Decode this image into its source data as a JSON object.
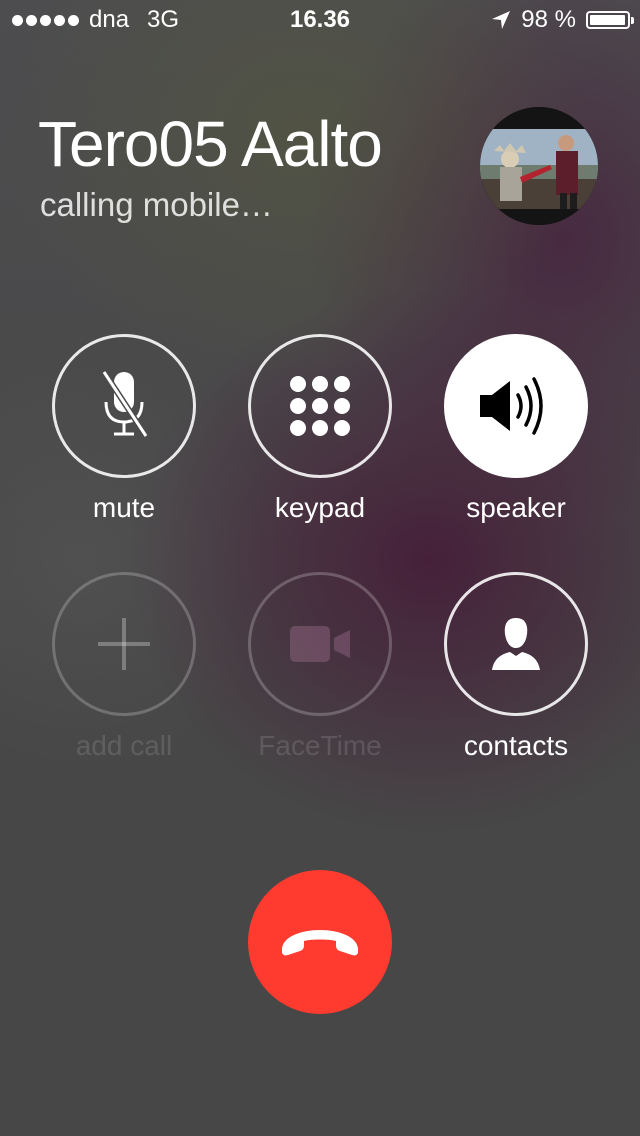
{
  "status_bar": {
    "carrier": "dna",
    "network": "3G",
    "time": "16.36",
    "battery": "98 %",
    "battery_level": 0.98,
    "icons": [
      "signal-dots-icon",
      "location-arrow-icon",
      "battery-icon"
    ]
  },
  "caller": {
    "name": "Tero05 Aalto",
    "status": "calling mobile…"
  },
  "controls": [
    {
      "id": "mute",
      "label": "mute",
      "icon": "mic-off-icon",
      "enabled": true,
      "active": false
    },
    {
      "id": "keypad",
      "label": "keypad",
      "icon": "keypad-icon",
      "enabled": true,
      "active": false
    },
    {
      "id": "speaker",
      "label": "speaker",
      "icon": "speaker-icon",
      "enabled": true,
      "active": true
    },
    {
      "id": "add-call",
      "label": "add call",
      "icon": "plus-icon",
      "enabled": false,
      "active": false
    },
    {
      "id": "facetime",
      "label": "FaceTime",
      "icon": "video-camera-icon",
      "enabled": false,
      "active": false
    },
    {
      "id": "contacts",
      "label": "contacts",
      "icon": "person-icon",
      "enabled": true,
      "active": false
    }
  ],
  "end_call": {
    "icon": "phone-hangup-icon",
    "color": "#ff3b30"
  }
}
